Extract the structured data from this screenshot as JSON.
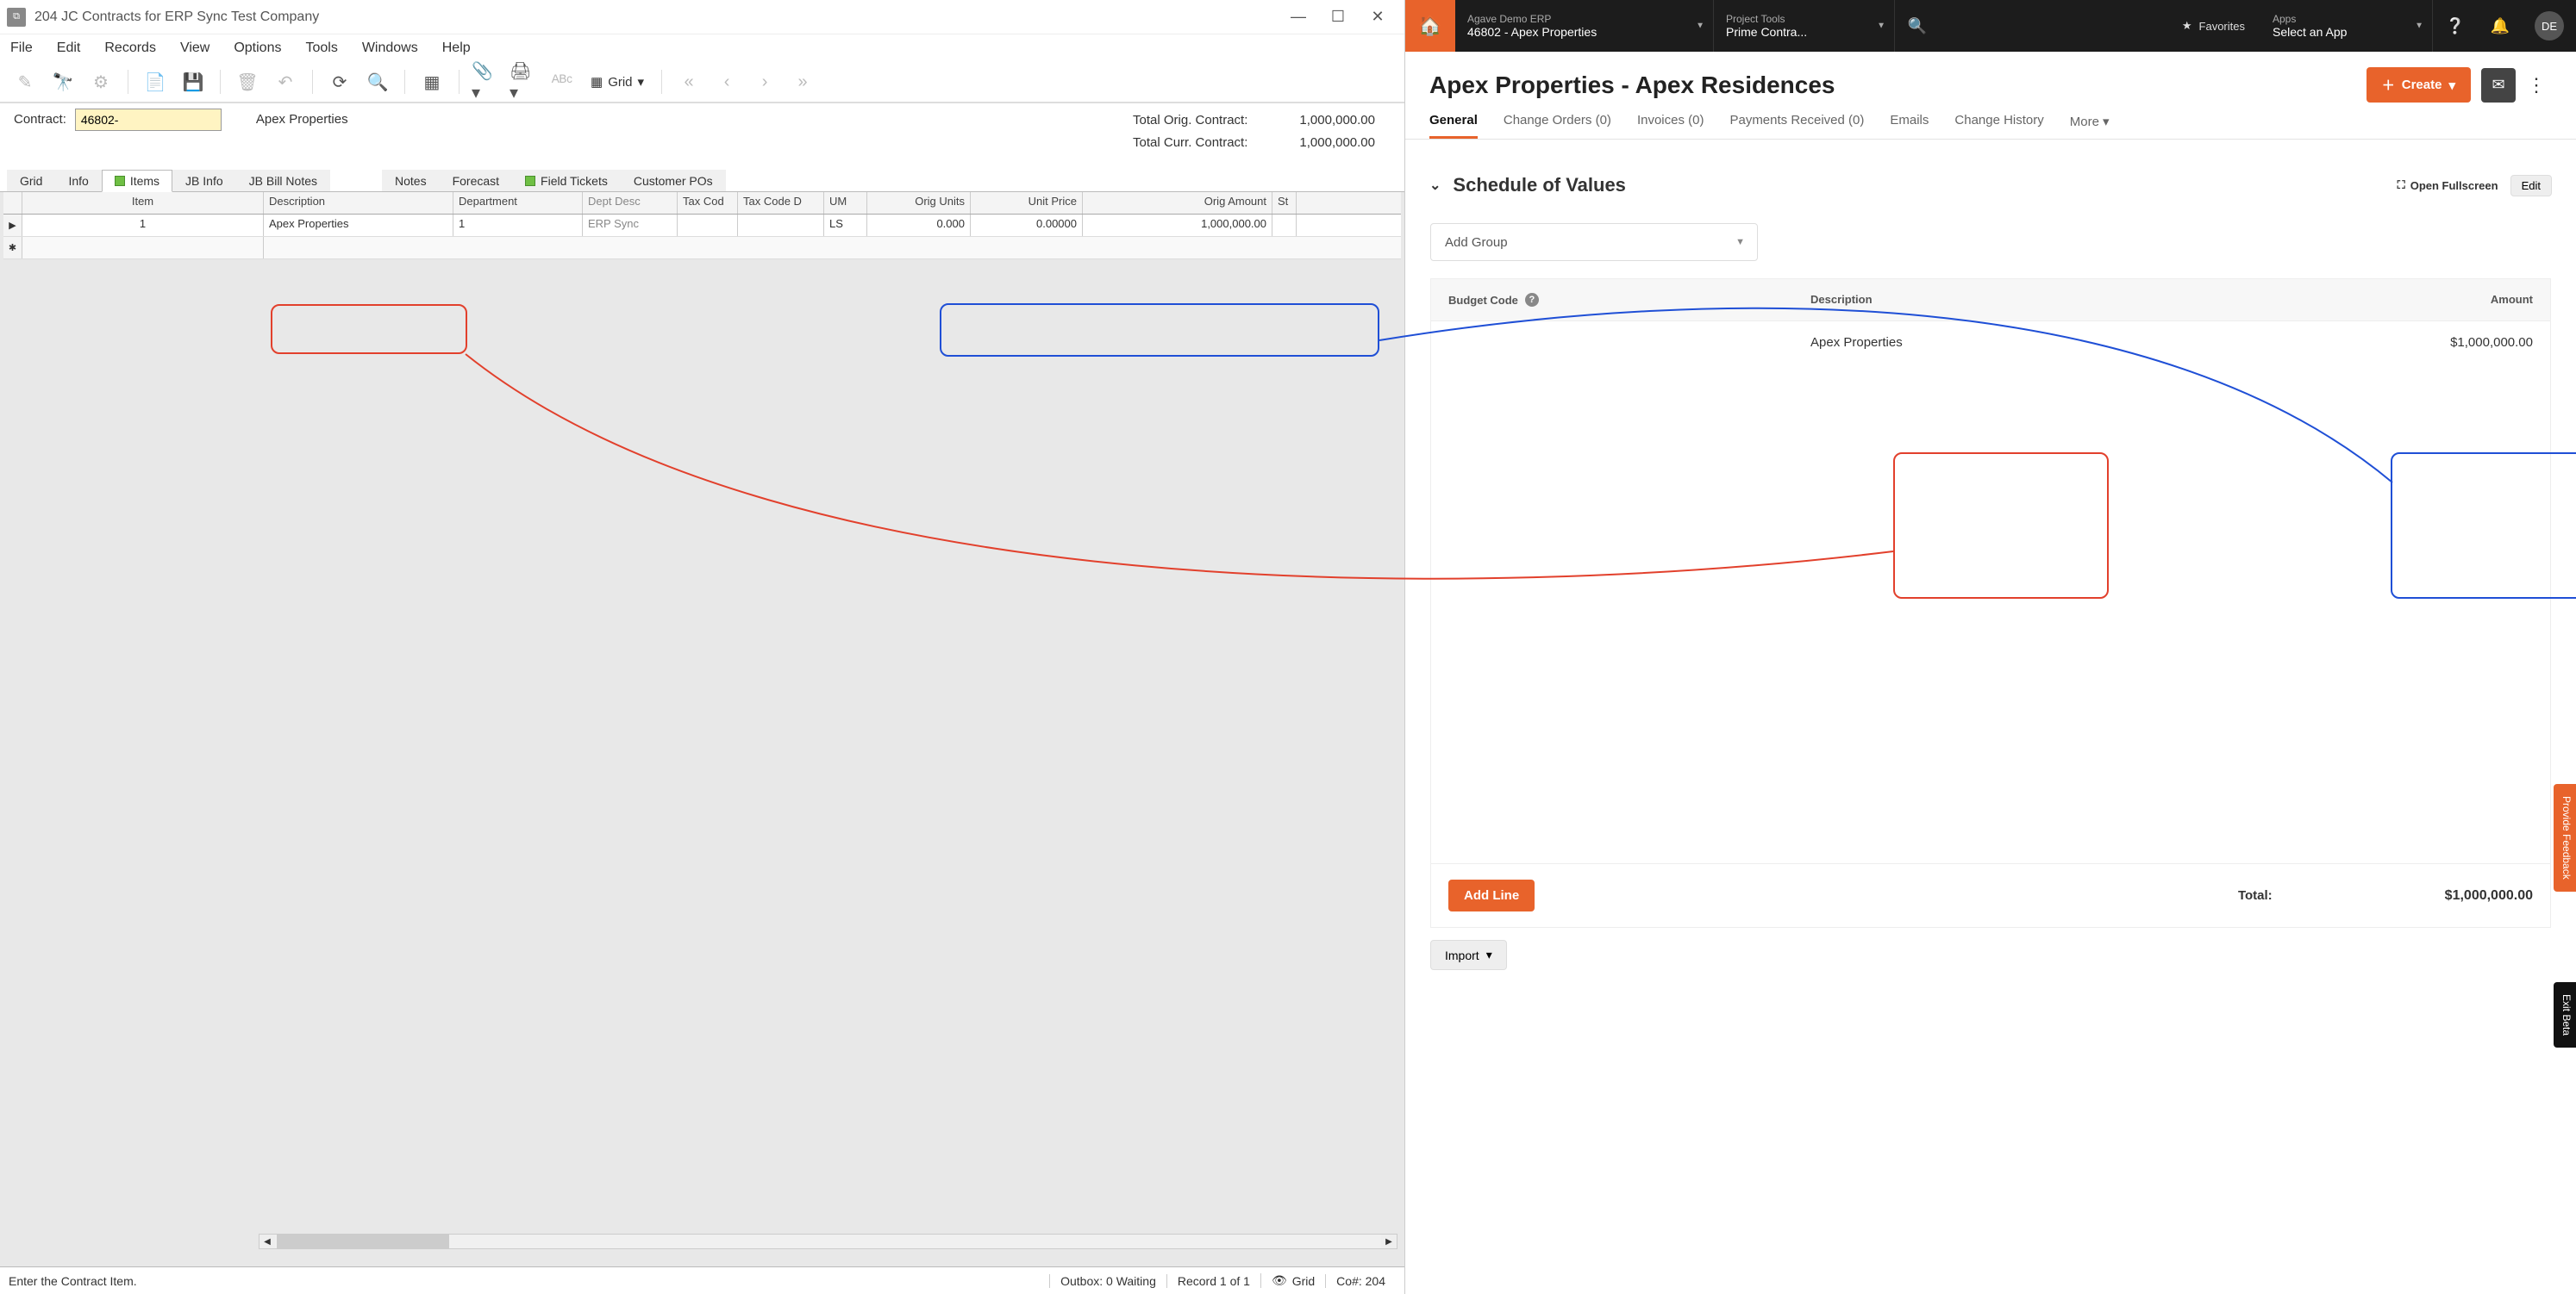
{
  "erp": {
    "window_title": "204 JC Contracts for ERP Sync Test Company",
    "menubar": [
      "File",
      "Edit",
      "Records",
      "View",
      "Options",
      "Tools",
      "Windows",
      "Help"
    ],
    "toolbar_grid_label": "Grid",
    "contract_label": "Contract:",
    "contract_value": "46802-",
    "customer_name": "Apex Properties",
    "totals": {
      "orig_label": "Total Orig. Contract:",
      "orig_value": "1,000,000.00",
      "curr_label": "Total Curr. Contract:",
      "curr_value": "1,000,000.00"
    },
    "tabs": [
      "Grid",
      "Info",
      "Items",
      "JB Info",
      "JB Bill Notes",
      "Notes",
      "Forecast",
      "Field Tickets",
      "Customer POs"
    ],
    "active_tab": "Items",
    "grid": {
      "columns": [
        "Item",
        "Description",
        "Department",
        "Dept Desc",
        "Tax Cod",
        "Tax Code D",
        "UM",
        "Orig Units",
        "Unit Price",
        "Orig Amount",
        "St"
      ],
      "row": {
        "item": "1",
        "description": "Apex Properties",
        "department": "1",
        "dept_desc": "ERP Sync",
        "tax_code": "",
        "tax_code_desc": "",
        "um": "LS",
        "orig_units": "0.000",
        "unit_price": "0.00000",
        "orig_amount": "1,000,000.00",
        "st": ""
      }
    },
    "status": {
      "hint": "Enter the Contract Item.",
      "outbox": "Outbox: 0 Waiting",
      "record": "Record 1 of 1",
      "view": "Grid",
      "co": "Co#: 204"
    }
  },
  "web": {
    "topbar": {
      "company_small": "Agave Demo ERP",
      "company_big": "46802 - Apex Properties",
      "tools_small": "Project Tools",
      "tools_big": "Prime Contra...",
      "favorites": "Favorites",
      "apps_small": "Apps",
      "apps_big": "Select an App",
      "avatar": "DE"
    },
    "page_title": "Apex Properties - Apex Residences",
    "create_label": "Create",
    "tabs": [
      "General",
      "Change Orders (0)",
      "Invoices (0)",
      "Payments Received (0)",
      "Emails",
      "Change History",
      "More"
    ],
    "sov": {
      "title": "Schedule of Values",
      "fullscreen": "Open Fullscreen",
      "edit": "Edit",
      "add_group": "Add Group",
      "columns": {
        "budget": "Budget Code",
        "description": "Description",
        "amount": "Amount"
      },
      "rows": [
        {
          "budget": "",
          "description": "Apex Properties",
          "amount": "$1,000,000.00"
        }
      ],
      "add_line": "Add Line",
      "total_label": "Total:",
      "total_value": "$1,000,000.00",
      "import": "Import"
    },
    "side": {
      "feedback": "Provide Feedback",
      "exit": "Exit Beta"
    }
  }
}
